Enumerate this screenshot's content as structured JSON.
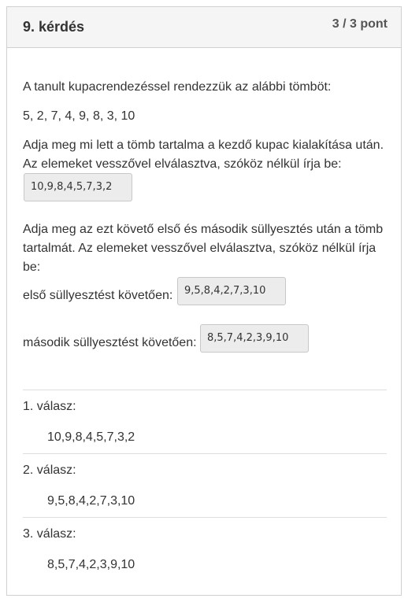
{
  "header": {
    "title": "9. kérdés",
    "points": "3 / 3 pont"
  },
  "question": {
    "intro": "A tanult kupacrendezéssel rendezzük az alábbi tömböt:",
    "array": "5, 2, 7, 4, 9, 8, 3, 10",
    "part1_line1": "Adja meg mi lett a tömb tartalma a kezdő kupac kialakítása után.",
    "part1_line2": "Az elemeket vesszővel elválasztva, szóköz nélkül írja be:",
    "part1_answer": "10,9,8,4,5,7,3,2",
    "part2_line1": "Adja meg az ezt követő első és második süllyesztés után a tömb",
    "part2_line2": "tartalmát.  Az elemeket vesszővel elválasztva, szóköz nélkül írja",
    "part2_line3": "be:",
    "first_label": "első süllyesztést követően:",
    "first_answer": "9,5,8,4,2,7,3,10",
    "second_label": "második süllyesztést követően:",
    "second_answer": "8,5,7,4,2,3,9,10"
  },
  "responses": [
    {
      "label": "1. válasz:",
      "value": "10,9,8,4,5,7,3,2"
    },
    {
      "label": "2. válasz:",
      "value": "9,5,8,4,2,7,3,10"
    },
    {
      "label": "3. válasz:",
      "value": "8,5,7,4,2,3,9,10"
    }
  ]
}
